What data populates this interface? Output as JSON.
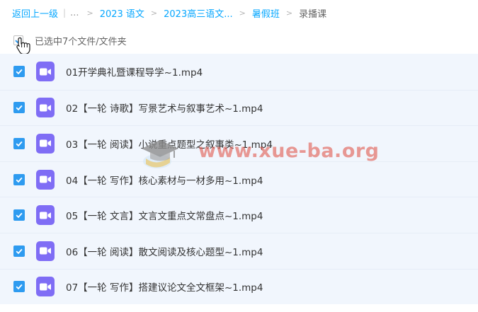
{
  "breadcrumb": {
    "back": "返回上一级",
    "ellipsis": "...",
    "items": [
      "2023 语文",
      "2023高三语文...",
      "暑假班"
    ],
    "current": "录播课"
  },
  "selection": {
    "text": "已选中7个文件/文件夹"
  },
  "files": [
    {
      "name": "01开学典礼暨课程导学~1.mp4",
      "checked": true
    },
    {
      "name": "02【一轮 诗歌】写景艺术与叙事艺术~1.mp4",
      "checked": true
    },
    {
      "name": "03【一轮 阅读】小说重点题型之叙事类~1.mp4",
      "checked": true
    },
    {
      "name": "04【一轮 写作】核心素材与一材多用~1.mp4",
      "checked": true
    },
    {
      "name": "05【一轮 文言】文言文重点文常盘点~1.mp4",
      "checked": true
    },
    {
      "name": "06【一轮 阅读】散文阅读及核心题型~1.mp4",
      "checked": true
    },
    {
      "name": "07【一轮 写作】搭建议论文全文框架~1.mp4",
      "checked": true
    }
  ],
  "watermark": {
    "text": "www.xue-ba.org"
  },
  "colors": {
    "link": "#06a7ff",
    "row_bg": "#f1f6fd",
    "checkbox": "#2e9bf0",
    "video_icon": "#7f6df5",
    "watermark": "#e15c52"
  },
  "icons": {
    "file": "video-file-icon",
    "check": "check-icon",
    "cursor": "hand-pointer-icon"
  }
}
